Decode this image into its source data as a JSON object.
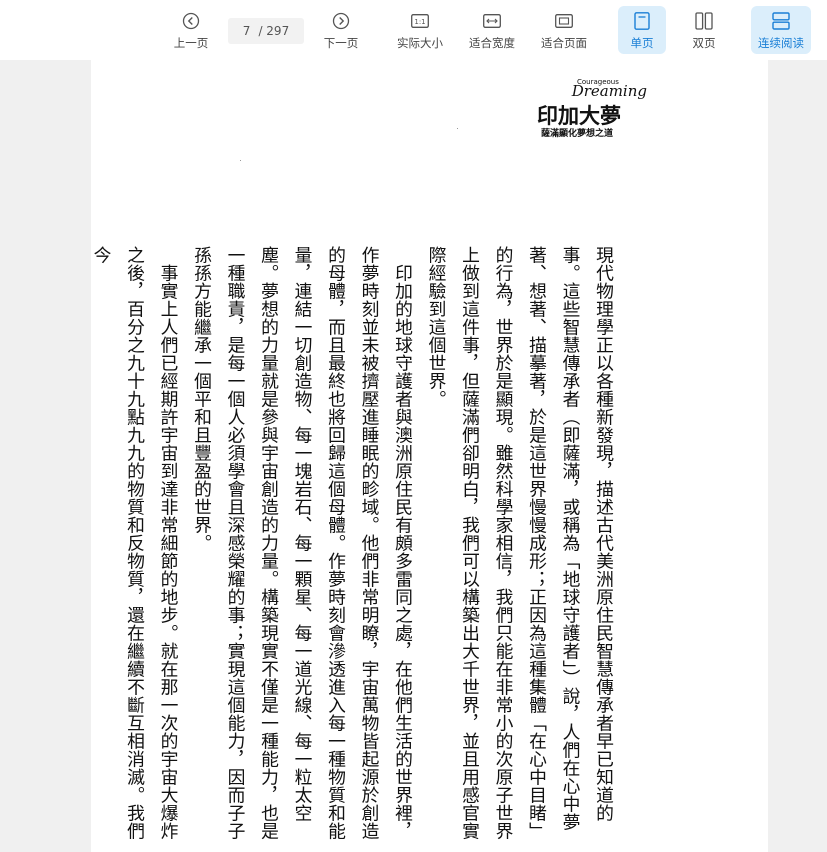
{
  "toolbar": {
    "prev_label": "上一页",
    "current_page": "7",
    "total_pages": "/ 297",
    "next_label": "下一页",
    "actual_size_label": "实际大小",
    "fit_width_label": "适合宽度",
    "fit_page_label": "适合页面",
    "single_page_label": "单页",
    "double_page_label": "双页",
    "continuous_label": "连续阅读",
    "active_color": "#1a7fd6"
  },
  "document": {
    "logo": {
      "small": "Courageous",
      "en": "Dreaming",
      "cn": "印加大夢",
      "sub": "薩滿顯化夢想之道"
    },
    "paragraphs": [
      "現代物理學正以各種新發現，描述古代美洲原住民智慧傳承者早已知道的事。這些智慧傳承者（即薩滿，或稱為「地球守護者」）說，人們在心中夢著、想著、描摹著，於是這世界慢慢成形；正因為這種集體「在心中目睹」的行為，世界於是顯現。雖然科學家相信，我們只能在非常小的次原子世界上做到這件事，但薩滿們卻明白，我們可以構築出大千世界，並且用感官實際經驗到這個世界。",
      "印加的地球守護者與澳洲原住民有頗多雷同之處，在他們生活的世界裡，作夢時刻並未被擠壓進睡眠的畛域。他們非常明瞭，宇宙萬物皆起源於創造的母體，而且最終也將回歸這個母體。作夢時刻會滲透進入每一種物質和能量，連結一切創造物、每一塊岩石、每一顆星、每一道光線、每一粒太空塵。夢想的力量就是參與宇宙創造的力量。構築現實不僅是一種能力，也是一種職責，是每一個人必須學會且深感榮耀的事；實現這個能力，因而子子孫孫方能繼承一個平和且豐盈的世界。",
      "事實上人們已經期許宇宙到達非常細節的地步。就在那一次的宇宙大爆炸之後，百分之九十九點九九的物質和反物質，還在繼續不斷互相消滅。我們今"
    ]
  }
}
